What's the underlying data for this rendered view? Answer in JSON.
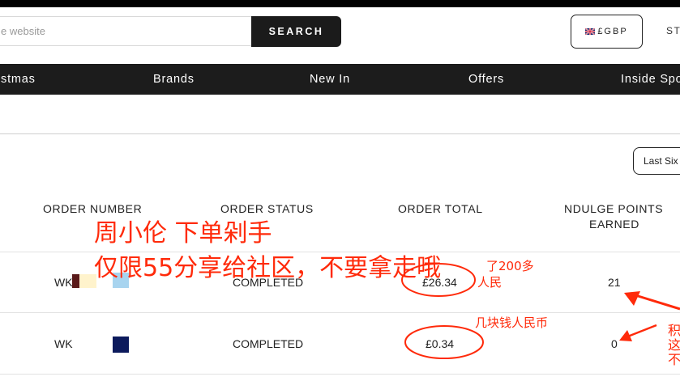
{
  "header": {
    "search": {
      "placeholder": "e website",
      "button_label": "SEARCH"
    },
    "currency": {
      "label": "£GBP"
    },
    "store_link": "STO"
  },
  "nav": {
    "items": [
      "istmas",
      "Brands",
      "New In",
      "Offers",
      "Inside Spo"
    ]
  },
  "filter": {
    "label": "Last Six"
  },
  "table": {
    "headers": {
      "order_number": "ORDER NUMBER",
      "order_status": "ORDER STATUS",
      "order_total": "ORDER TOTAL",
      "points_line1": "NDULGE POINTS",
      "points_line2": "EARNED"
    },
    "rows": [
      {
        "order_number": "WK",
        "status": "COMPLETED",
        "total": "£26.34",
        "points": "21",
        "swatch_colors": [
          "#5a1a1a",
          "#fff3cc",
          "#a8d4ef"
        ]
      },
      {
        "order_number": "WK",
        "status": "COMPLETED",
        "total": "£0.34",
        "points": "0",
        "swatch_colors": [
          "#0c1a5c"
        ]
      }
    ]
  },
  "annotations": {
    "title_line1": "周小伦 下单剁手",
    "title_line2": "仅限55分享给社区，不要拿走哦",
    "note_row1_a": "了200多",
    "note_row1_b": "人民",
    "note_row2": "几块钱人民币",
    "side_1": "积",
    "side_2": "这",
    "side_3": "不",
    "color": "#ff2a0a"
  }
}
